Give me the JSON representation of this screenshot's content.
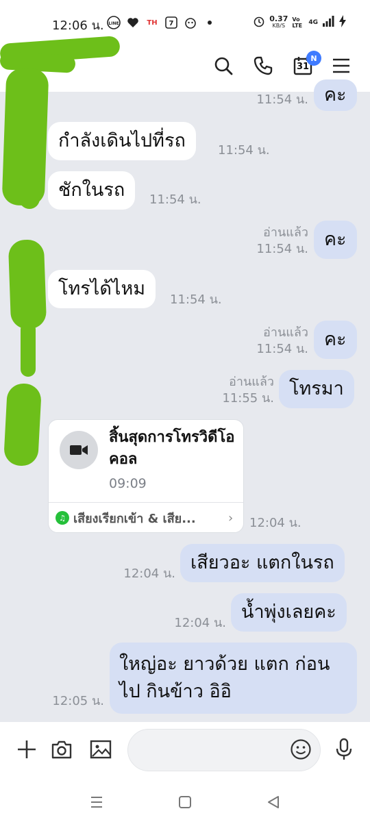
{
  "status_bar": {
    "time": "12:06 น.",
    "notif_icons": [
      "line-icon",
      "heart-icon",
      "th-icon",
      "seven-eleven-icon",
      "character-icon",
      "dot-icon"
    ],
    "data_speed": "0.37",
    "data_unit": "KB/S",
    "vo_lte": "Vo LTE",
    "network": "4G"
  },
  "header": {
    "calendar_day": "31",
    "calendar_badge": "N"
  },
  "messages": [
    {
      "dir": "out",
      "text": "คะ",
      "time": "11:54 น.",
      "read": ""
    },
    {
      "dir": "in",
      "text": "กำลังเดินไปที่รถ",
      "time": "11:54 น."
    },
    {
      "dir": "in",
      "text": "ชักในรถ",
      "time": "11:54 น."
    },
    {
      "dir": "out",
      "text": "คะ",
      "time": "11:54 น.",
      "read": "อ่านแล้ว"
    },
    {
      "dir": "in",
      "text": "โทรได้ไหม",
      "time": "11:54 น."
    },
    {
      "dir": "out",
      "text": "คะ",
      "time": "11:54 น.",
      "read": "อ่านแล้ว"
    },
    {
      "dir": "out",
      "text": "โทรมา",
      "time": "11:55 น.",
      "read": "อ่านแล้ว"
    },
    {
      "dir": "out",
      "text": "เสียวอะ แตกในรถ",
      "time": "12:04 น.",
      "read": ""
    },
    {
      "dir": "out",
      "text": "น้ำพุ่งเลยคะ",
      "time": "12:04 น.",
      "read": ""
    },
    {
      "dir": "out",
      "text_line1": "ใหญ่อะ ยาวด้วย แตก ก่อน",
      "text_line2": "ไป กินข้าว อิอิ",
      "time": "12:05 น.",
      "read": ""
    }
  ],
  "call_card": {
    "title": "สิ้นสุดการโทรวิดีโอคอล",
    "duration": "09:09",
    "link_text": "เสียงเรียกเข้า & เสีย...",
    "time": "12:04 น."
  },
  "input": {
    "placeholder": ""
  }
}
